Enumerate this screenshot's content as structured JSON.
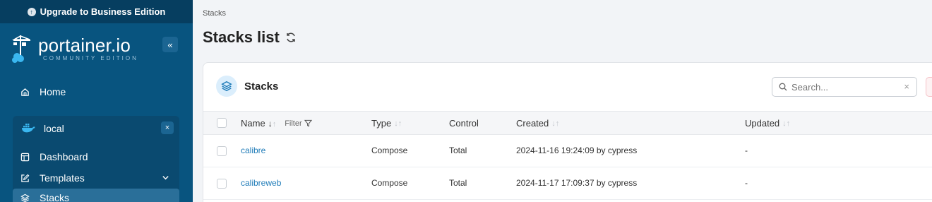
{
  "sidebar": {
    "upgrade_label": "Upgrade to Business Edition",
    "logo_main": "portainer.io",
    "logo_sub": "COMMUNITY EDITION",
    "collapse_glyph": "«",
    "home_label": "Home",
    "environment": {
      "name": "local",
      "close_glyph": "×"
    },
    "env_items": [
      {
        "label": "Dashboard",
        "icon": "dashboard-icon"
      },
      {
        "label": "Templates",
        "icon": "templates-icon"
      },
      {
        "label": "Stacks",
        "icon": "stacks-icon"
      }
    ]
  },
  "header": {
    "breadcrumb": "Stacks",
    "title": "Stacks list"
  },
  "card": {
    "title": "Stacks",
    "search_placeholder": "Search...",
    "clear_glyph": "×",
    "columns": {
      "name": "Name",
      "filter": "Filter",
      "type": "Type",
      "control": "Control",
      "created": "Created",
      "updated": "Updated"
    },
    "rows": [
      {
        "name": "calibre",
        "type": "Compose",
        "control": "Total",
        "created": "2024-11-16 19:24:09 by cypress",
        "updated": "-"
      },
      {
        "name": "calibreweb",
        "type": "Compose",
        "control": "Total",
        "created": "2024-11-17 17:09:37 by cypress",
        "updated": "-"
      }
    ]
  },
  "colors": {
    "sidebar_bg": "#08547f",
    "upgrade_bg": "#063e60",
    "link": "#1e7bb8",
    "accent_light": "#dbeefc"
  }
}
